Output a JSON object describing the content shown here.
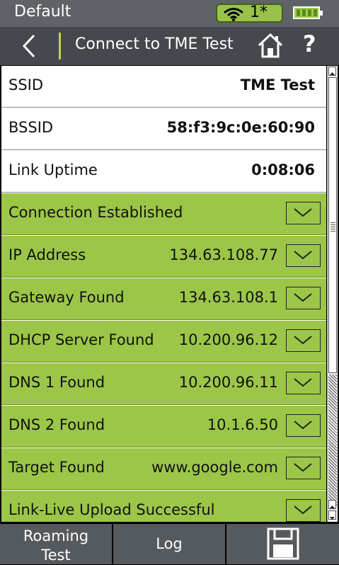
{
  "status": {
    "profile": "Default",
    "wifi_count": "1*",
    "battery_level": 1.0
  },
  "header": {
    "title": "Connect to TME Test"
  },
  "info_rows": [
    {
      "label": "SSID",
      "value": "TME Test"
    },
    {
      "label": "BSSID",
      "value": "58:f3:9c:0e:60:90"
    },
    {
      "label": "Link Uptime",
      "value": "0:08:06"
    }
  ],
  "steps": [
    {
      "label": "Connection Established",
      "value": ""
    },
    {
      "label": "IP Address",
      "value": "134.63.108.77"
    },
    {
      "label": "Gateway Found",
      "value": "134.63.108.1"
    },
    {
      "label": "DHCP Server Found",
      "value": "10.200.96.12"
    },
    {
      "label": "DNS 1 Found",
      "value": "10.200.96.11"
    },
    {
      "label": "DNS 2 Found",
      "value": "10.1.6.50"
    },
    {
      "label": "Target Found",
      "value": "www.google.com"
    },
    {
      "label": "Link-Live Upload Successful",
      "value": ""
    }
  ],
  "footer": {
    "roaming_line1": "Roaming",
    "roaming_line2": "Test",
    "log": "Log",
    "save_icon": "save-icon"
  },
  "colors": {
    "success_green": "#9cc648",
    "header_gray": "#45484c",
    "status_gray": "#5f6266"
  }
}
